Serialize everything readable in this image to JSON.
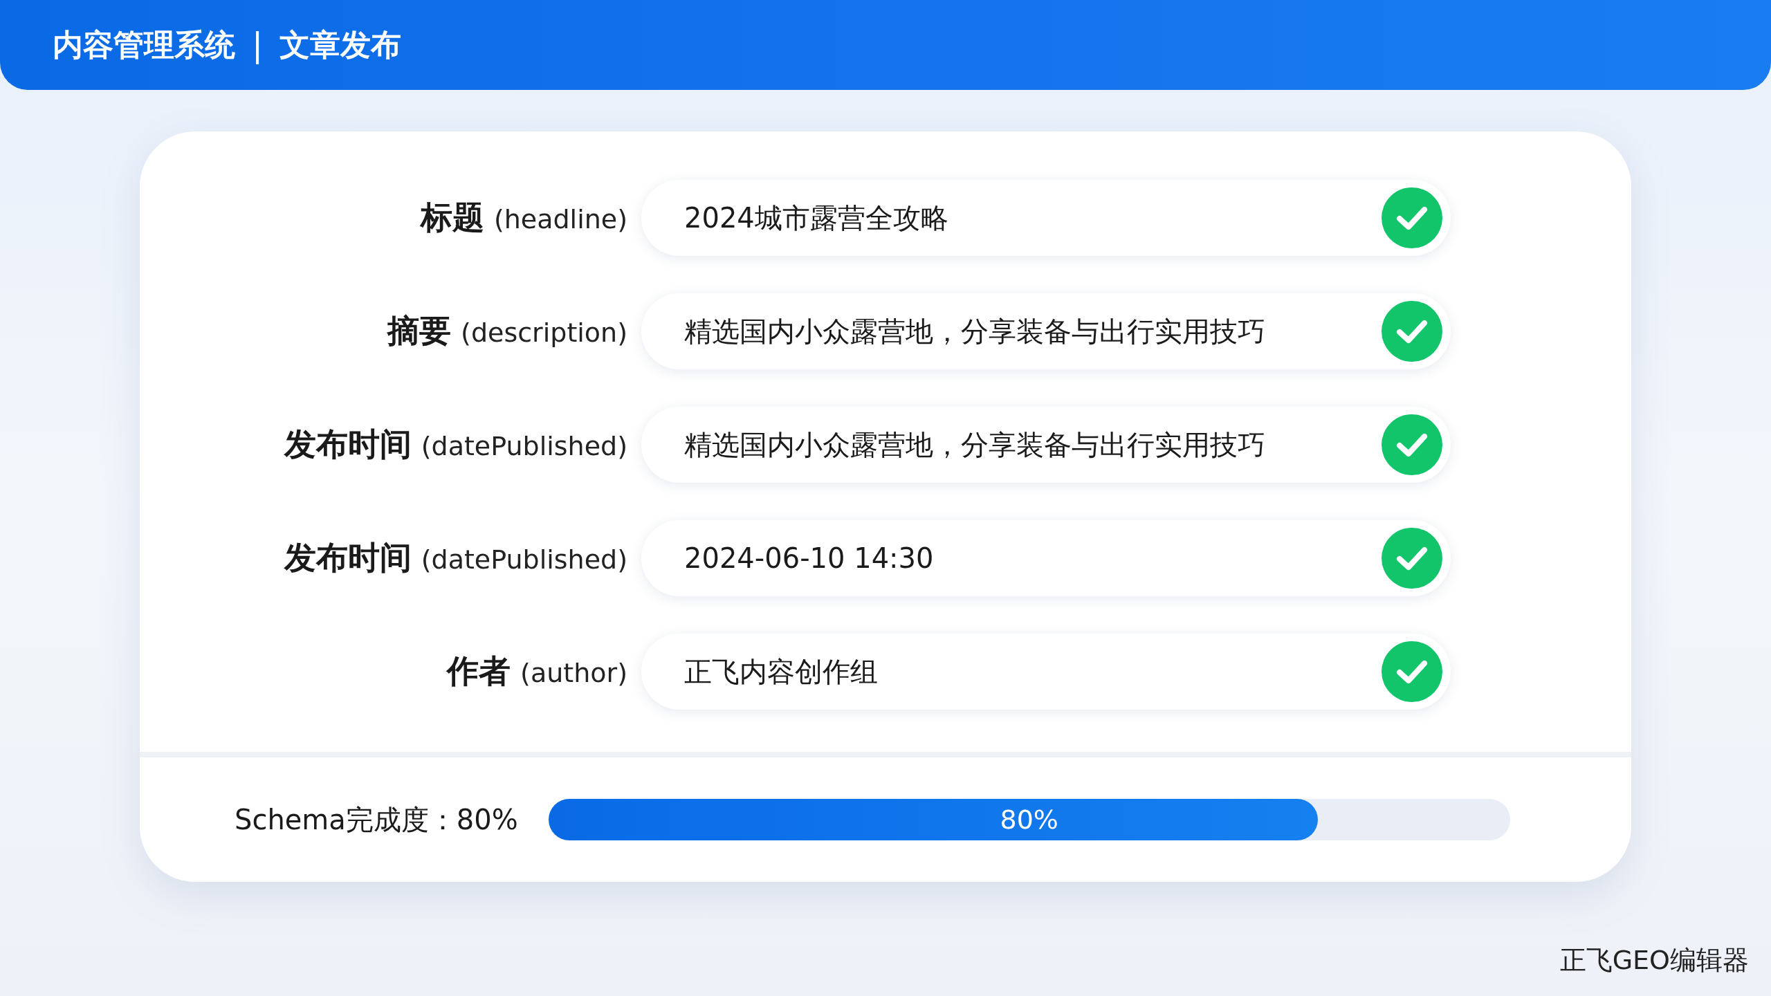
{
  "header": {
    "system": "内容管理系统",
    "separator": "|",
    "page": "文章发布"
  },
  "fields": [
    {
      "label": "标题",
      "key": "(headline)",
      "value": "2024城市露营全攻略",
      "valid": true
    },
    {
      "label": "摘要",
      "key": "(description)",
      "value": "精选国内小众露营地，分享装备与出行实用技巧",
      "valid": true
    },
    {
      "label": "发布时间",
      "key": "(datePublished)",
      "value": "精选国内小众露营地，分享装备与出行实用技巧",
      "valid": true
    },
    {
      "label": "发布时间",
      "key": "(datePublished)",
      "value": "2024-06-10 14:30",
      "valid": true
    },
    {
      "label": "作者",
      "key": "(author)",
      "value": "正飞内容创作组",
      "valid": true
    }
  ],
  "progress": {
    "label": "Schema完成度：80%",
    "level": 0.8,
    "reading": "80%"
  },
  "footer": "正飞GEO编辑器"
}
